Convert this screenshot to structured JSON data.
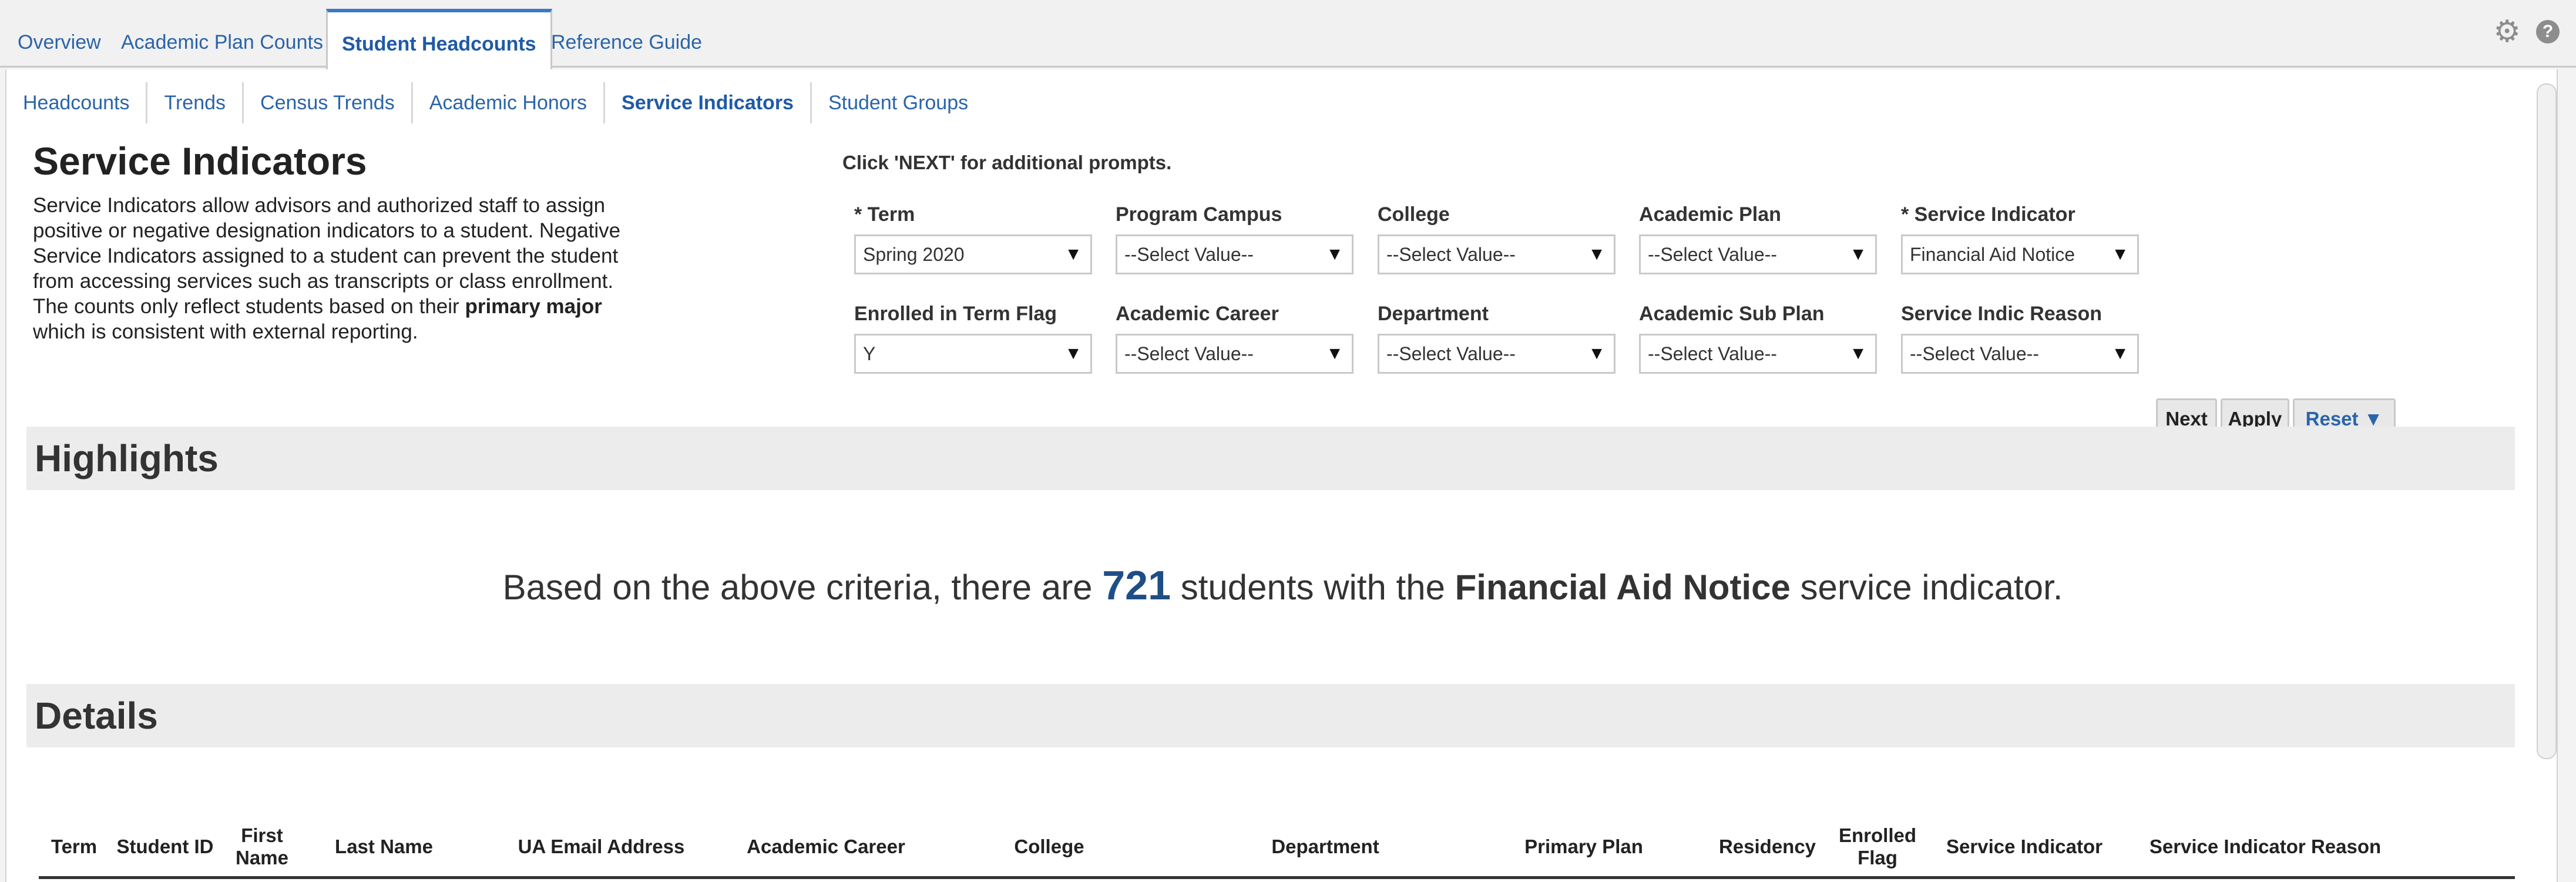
{
  "top_tabs": [
    "Overview",
    "Academic Plan Counts",
    "Student Headcounts",
    "Reference Guide"
  ],
  "top_icons": {
    "settings": "gear-icon",
    "help": "help-icon",
    "help_glyph": "?",
    "gear_glyph": "⚙"
  },
  "sub_tabs": [
    "Headcounts",
    "Trends",
    "Census Trends",
    "Academic Honors",
    "Service Indicators",
    "Student Groups"
  ],
  "page": {
    "title": "Service Indicators",
    "desc_part1": "Service Indicators allow advisors and authorized staff to assign positive or negative designation indicators to a student. Negative Service Indicators assigned to a student can prevent the student from accessing services such as transcripts or class enrollment. The counts only reflect students based on their ",
    "desc_bold": "primary major",
    "desc_part2": " which is consistent with external reporting."
  },
  "prompts": {
    "hint": "Click 'NEXT' for additional prompts.",
    "row1": [
      {
        "label": "* Term",
        "value": "Spring 2020"
      },
      {
        "label": "Program Campus",
        "value": "--Select Value--"
      },
      {
        "label": "College",
        "value": "--Select Value--"
      },
      {
        "label": "Academic Plan",
        "value": "--Select Value--"
      },
      {
        "label": "* Service Indicator",
        "value": "Financial Aid Notice"
      }
    ],
    "row2": [
      {
        "label": "Enrolled in Term Flag",
        "value": "Y"
      },
      {
        "label": "Academic Career",
        "value": "--Select Value--"
      },
      {
        "label": "Department",
        "value": "--Select Value--"
      },
      {
        "label": "Academic Sub Plan",
        "value": "--Select Value--"
      },
      {
        "label": "Service Indic Reason",
        "value": "--Select Value--"
      }
    ],
    "arrow": "▼",
    "buttons": {
      "next": "Next",
      "apply": "Apply",
      "reset": "Reset ▼"
    }
  },
  "highlights": {
    "title": "Highlights",
    "text_before": "Based on the above criteria, there are ",
    "count": "721",
    "text_mid": " students with the ",
    "indicator": "Financial Aid Notice",
    "text_after": " service indicator."
  },
  "details": {
    "title": "Details",
    "columns": [
      "Term",
      "Student ID",
      "First Name",
      "Last Name",
      "UA Email Address",
      "Academic Career",
      "College",
      "Department",
      "Primary Plan",
      "Residency",
      "Enrolled Flag",
      "Service Indicator",
      "Service Indicator Reason"
    ]
  }
}
